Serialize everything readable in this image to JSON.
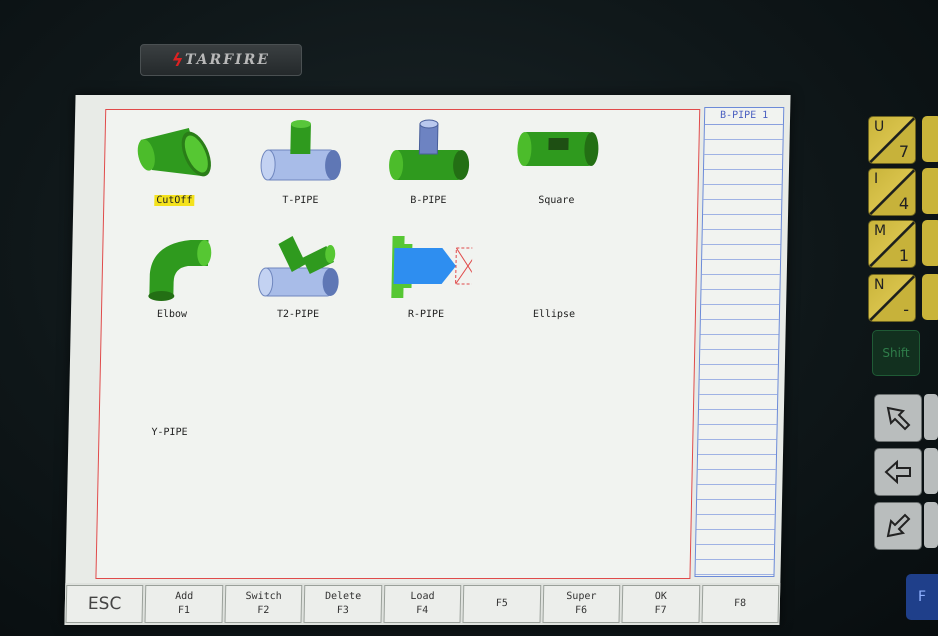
{
  "brand": {
    "name": "TARFIRE"
  },
  "side_panel": {
    "title": "B-PIPE 1"
  },
  "shapes": [
    {
      "label": "CutOff",
      "selected": true
    },
    {
      "label": "T-PIPE"
    },
    {
      "label": "B-PIPE"
    },
    {
      "label": "Square"
    },
    {
      "label": "Elbow"
    },
    {
      "label": "T2-PIPE"
    },
    {
      "label": "R-PIPE"
    },
    {
      "label": "Ellipse"
    },
    {
      "label": "Y-PIPE"
    }
  ],
  "function_keys": [
    {
      "top": "ESC",
      "bottom": ""
    },
    {
      "top": "Add",
      "bottom": "F1"
    },
    {
      "top": "Switch",
      "bottom": "F2"
    },
    {
      "top": "Delete",
      "bottom": "F3"
    },
    {
      "top": "Load",
      "bottom": "F4"
    },
    {
      "top": "",
      "bottom": "F5"
    },
    {
      "top": "Super",
      "bottom": "F6"
    },
    {
      "top": "OK",
      "bottom": "F7"
    },
    {
      "top": "",
      "bottom": "F8"
    }
  ],
  "hardware_keys": [
    {
      "top": "U",
      "bottom": "7"
    },
    {
      "top": "I",
      "bottom": "4"
    },
    {
      "top": "M",
      "bottom": "1"
    },
    {
      "top": "N",
      "bottom": "-"
    }
  ],
  "shift_key": "Shift",
  "blue_key": "F",
  "colors": {
    "pipe_green": "#2f9a1e",
    "pipe_blue": "#9fb6e8",
    "selected_highlight": "#f4e21c",
    "frame_red": "#e04a4a",
    "panel_blue": "#6b8ad8"
  }
}
